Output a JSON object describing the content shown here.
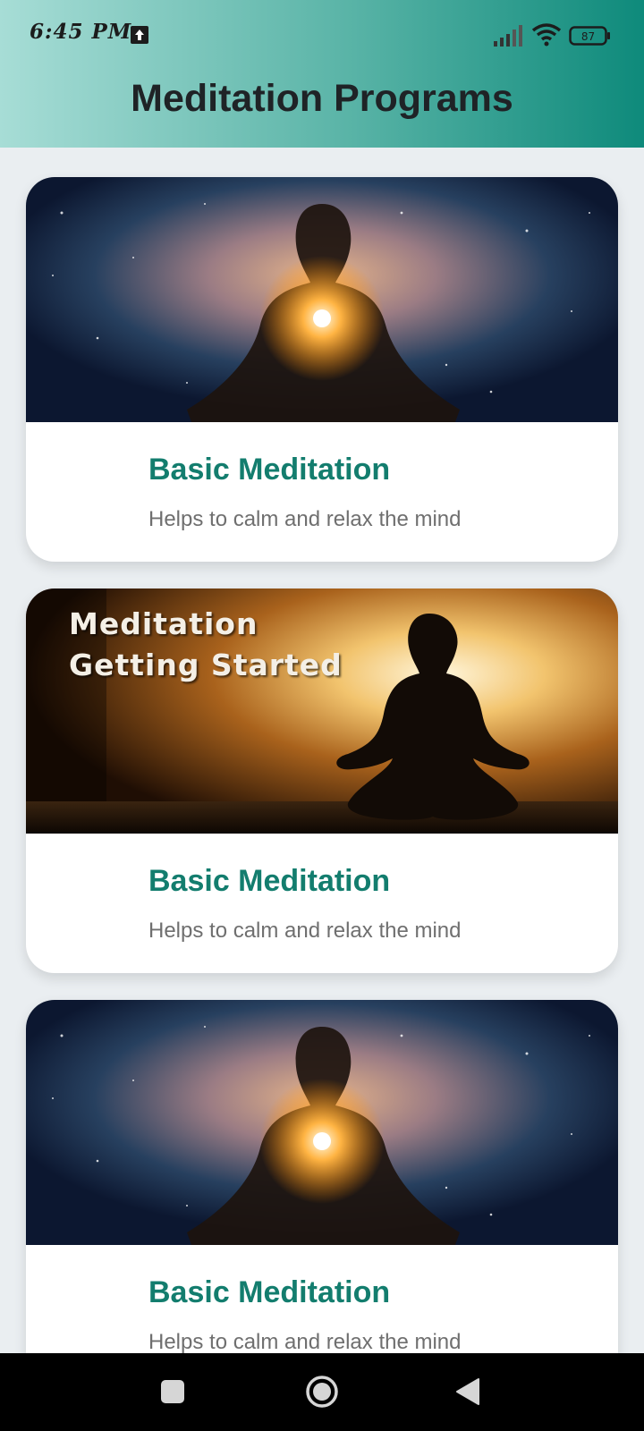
{
  "status_bar": {
    "time": "6:45 PM",
    "battery": "87",
    "icons": [
      "upload-icon",
      "signal-icon",
      "wifi-icon",
      "battery-icon"
    ]
  },
  "header": {
    "title": "Meditation Programs"
  },
  "programs": [
    {
      "image": "cosmic-meditation-image",
      "title": "Basic Meditation",
      "subtitle": "Helps to calm and relax the mind"
    },
    {
      "image": "sunset-meditation-image",
      "image_text_line1": "Meditation",
      "image_text_line2": "Getting Started",
      "title": "Basic Meditation",
      "subtitle": "Helps to calm and relax the mind"
    },
    {
      "image": "cosmic-meditation-image",
      "title": "Basic Meditation",
      "subtitle": "Helps to calm and relax the mind"
    }
  ],
  "nav_bar": {
    "icons": [
      "recents-square-icon",
      "home-circle-icon",
      "back-triangle-icon"
    ]
  },
  "colors": {
    "header_start": "#a7ddd6",
    "header_end": "#0e8a7b",
    "accent": "#137d6e",
    "background": "#eaeef1"
  }
}
